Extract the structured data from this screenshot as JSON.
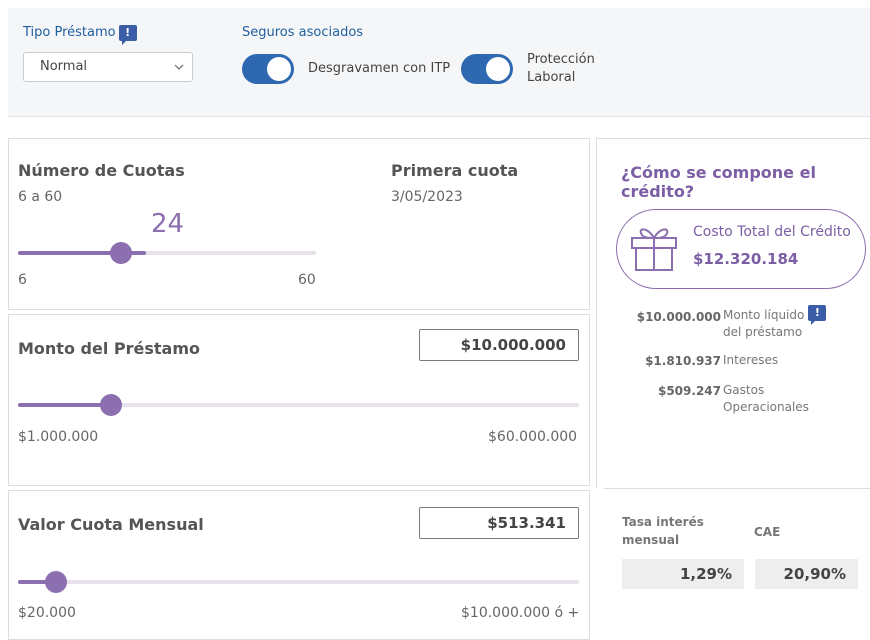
{
  "header": {
    "loan_type_label": "Tipo Préstamo",
    "info_glyph": "!",
    "loan_type_value": "Normal",
    "insurance_label": "Seguros asociados",
    "insurance1_label": "Desgravamen con ITP",
    "insurance2_line1": "Protección",
    "insurance2_line2": "Laboral",
    "insurance1_on": true,
    "insurance2_on": true
  },
  "installments": {
    "title": "Número de Cuotas",
    "range": "6 a 60",
    "value": "24",
    "min": "6",
    "max": "60",
    "slider_fraction": 0.33
  },
  "first_payment": {
    "title": "Primera cuota",
    "date": "3/05/2023"
  },
  "loan_amount": {
    "title": "Monto del Préstamo",
    "value": "$10.000.000",
    "min": "$1.000.000",
    "max": "$60.000.000",
    "slider_fraction": 0.16
  },
  "monthly_payment": {
    "title": "Valor Cuota Mensual",
    "value": "$513.341",
    "min": "$20.000",
    "max": "$10.000.000 ó +",
    "slider_fraction": 0.07
  },
  "composition": {
    "title": "¿Cómo se compone el crédito?",
    "total_label": "Costo Total del Crédito",
    "total_value": "$12.320.184",
    "items": [
      {
        "value": "$10.000.000",
        "label_l1": "Monto líquido",
        "label_l2": "del préstamo"
      },
      {
        "value": "$1.810.937",
        "label_l1": "Intereses",
        "label_l2": ""
      },
      {
        "value": "$509.247",
        "label_l1": "Gastos",
        "label_l2": "Operacionales"
      }
    ]
  },
  "rates": {
    "monthly_label_l1": "Tasa interés",
    "monthly_label_l2": "mensual",
    "monthly_value": "1,29%",
    "cae_label": "CAE",
    "cae_value": "20,90%"
  },
  "colors": {
    "primary_blue": "#2e68b1",
    "accent_purple": "#8c6fae",
    "title_purple": "#7b5ea3"
  }
}
